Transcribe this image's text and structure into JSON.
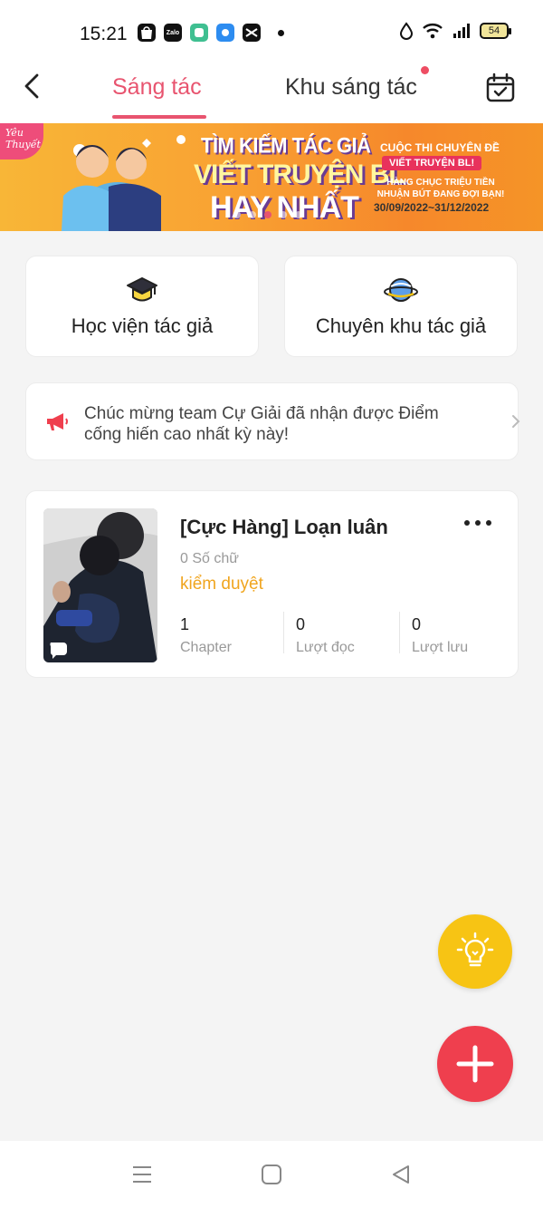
{
  "status_bar": {
    "time": "15:21",
    "notification_icons": [
      "shopee-icon",
      "zalo-icon",
      "green-app-icon",
      "blue-app-icon",
      "capcut-icon"
    ],
    "zalo_label": "Zalo",
    "battery": "54"
  },
  "header": {
    "tabs": [
      {
        "label": "Sáng tác",
        "active": true
      },
      {
        "label": "Khu sáng tác",
        "active": false,
        "has_dot": true
      }
    ]
  },
  "banner": {
    "brand": "Yêu Thuyết",
    "headline1": "TÌM KIẾM TÁC GIẢ",
    "headline2": "VIẾT TRUYỆN BL",
    "headline3": "HAY NHẤT",
    "contest_title": "CUỘC THI CHUYÊN ĐỀ",
    "contest_tag": "VIẾT TRUYỆN BL!",
    "prize": "HÀNG CHỤC TRIỆU TIỀN NHUẬN BÚT ĐANG ĐỢI BẠN!",
    "dates": "30/09/2022~31/12/2022",
    "slide_count": 5,
    "active_slide": 3
  },
  "shortcuts": [
    {
      "label": "Học viện tác giả",
      "icon": "graduation-cap-icon"
    },
    {
      "label": "Chuyên khu tác giả",
      "icon": "planet-icon"
    }
  ],
  "notice": {
    "text": "Chúc mừng team Cự Giải đã nhận được Điểm cống hiến cao nhất kỳ này!"
  },
  "story": {
    "title": "[Cực Hàng] Loạn luân",
    "word_count": "0 Số chữ",
    "status": "kiểm duyệt",
    "stats": [
      {
        "value": "1",
        "label": "Chapter"
      },
      {
        "value": "0",
        "label": "Lượt đọc"
      },
      {
        "value": "0",
        "label": "Lượt lưu"
      }
    ]
  },
  "colors": {
    "accent": "#e8546f",
    "status_pending": "#f0a51e",
    "fab_idea": "#f7c414",
    "fab_add": "#ef3f4e",
    "background": "#f4f4f4"
  }
}
